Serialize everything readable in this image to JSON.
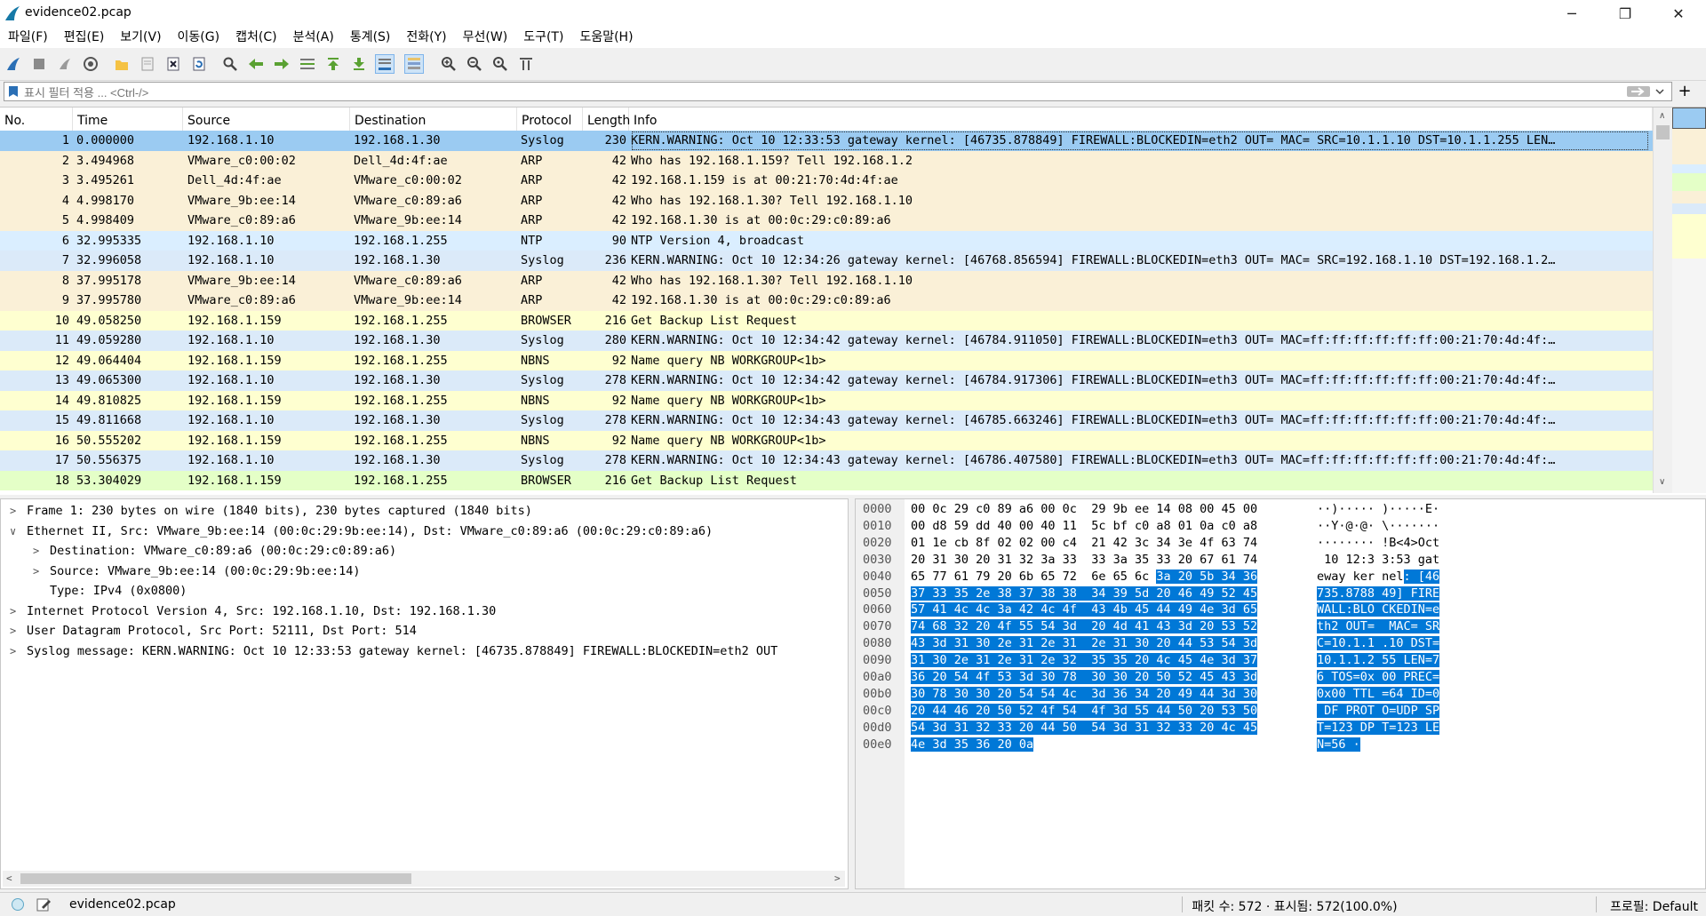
{
  "window": {
    "title": "evidence02.pcap",
    "minimize": "─",
    "maximize": "❐",
    "close": "✕"
  },
  "menu": [
    "파일(F)",
    "편집(E)",
    "보기(V)",
    "이동(G)",
    "캡처(C)",
    "분석(A)",
    "통계(S)",
    "전화(Y)",
    "무선(W)",
    "도구(T)",
    "도움말(H)"
  ],
  "filter": {
    "placeholder": "표시 필터 적용 ... <Ctrl-/>",
    "apply_icon": "arrow-right-icon",
    "add": "+"
  },
  "columns": {
    "no": "No.",
    "time": "Time",
    "source": "Source",
    "destination": "Destination",
    "protocol": "Protocol",
    "length": "Length",
    "info": "Info"
  },
  "colors": {
    "syslog": "#dbeaf9",
    "arp": "#faf0d7",
    "ntp": "#daeeff",
    "browser": "#feffd0",
    "nbns": "#feffd0",
    "last_browser": "#e4ffc7",
    "selected": "#9bcbf2",
    "highlight": "#0078d7"
  },
  "packets": [
    {
      "no": "1",
      "time": "0.000000",
      "src": "192.168.1.10",
      "dst": "192.168.1.30",
      "proto": "Syslog",
      "len": "230",
      "info": "KERN.WARNING: Oct 10 12:33:53 gateway kernel: [46735.878849] FIREWALL:BLOCKEDIN=eth2 OUT= MAC= SRC=10.1.1.10 DST=10.1.1.255 LEN…",
      "kind": "selected"
    },
    {
      "no": "2",
      "time": "3.494968",
      "src": "VMware_c0:00:02",
      "dst": "Dell_4d:4f:ae",
      "proto": "ARP",
      "len": "42",
      "info": "Who has 192.168.1.159? Tell 192.168.1.2",
      "kind": "arp"
    },
    {
      "no": "3",
      "time": "3.495261",
      "src": "Dell_4d:4f:ae",
      "dst": "VMware_c0:00:02",
      "proto": "ARP",
      "len": "42",
      "info": "192.168.1.159 is at 00:21:70:4d:4f:ae",
      "kind": "arp"
    },
    {
      "no": "4",
      "time": "4.998170",
      "src": "VMware_9b:ee:14",
      "dst": "VMware_c0:89:a6",
      "proto": "ARP",
      "len": "42",
      "info": "Who has 192.168.1.30? Tell 192.168.1.10",
      "kind": "arp"
    },
    {
      "no": "5",
      "time": "4.998409",
      "src": "VMware_c0:89:a6",
      "dst": "VMware_9b:ee:14",
      "proto": "ARP",
      "len": "42",
      "info": "192.168.1.30 is at 00:0c:29:c0:89:a6",
      "kind": "arp"
    },
    {
      "no": "6",
      "time": "32.995335",
      "src": "192.168.1.10",
      "dst": "192.168.1.255",
      "proto": "NTP",
      "len": "90",
      "info": "NTP Version 4, broadcast",
      "kind": "ntp"
    },
    {
      "no": "7",
      "time": "32.996058",
      "src": "192.168.1.10",
      "dst": "192.168.1.30",
      "proto": "Syslog",
      "len": "236",
      "info": "KERN.WARNING: Oct 10 12:34:26 gateway kernel: [46768.856594] FIREWALL:BLOCKEDIN=eth3 OUT= MAC= SRC=192.168.1.10 DST=192.168.1.2…",
      "kind": "syslog"
    },
    {
      "no": "8",
      "time": "37.995178",
      "src": "VMware_9b:ee:14",
      "dst": "VMware_c0:89:a6",
      "proto": "ARP",
      "len": "42",
      "info": "Who has 192.168.1.30? Tell 192.168.1.10",
      "kind": "arp"
    },
    {
      "no": "9",
      "time": "37.995780",
      "src": "VMware_c0:89:a6",
      "dst": "VMware_9b:ee:14",
      "proto": "ARP",
      "len": "42",
      "info": "192.168.1.30 is at 00:0c:29:c0:89:a6",
      "kind": "arp"
    },
    {
      "no": "10",
      "time": "49.058250",
      "src": "192.168.1.159",
      "dst": "192.168.1.255",
      "proto": "BROWSER",
      "len": "216",
      "info": "Get Backup List Request",
      "kind": "browser"
    },
    {
      "no": "11",
      "time": "49.059280",
      "src": "192.168.1.10",
      "dst": "192.168.1.30",
      "proto": "Syslog",
      "len": "280",
      "info": "KERN.WARNING: Oct 10 12:34:42 gateway kernel: [46784.911050] FIREWALL:BLOCKEDIN=eth3 OUT= MAC=ff:ff:ff:ff:ff:ff:00:21:70:4d:4f:…",
      "kind": "syslog"
    },
    {
      "no": "12",
      "time": "49.064404",
      "src": "192.168.1.159",
      "dst": "192.168.1.255",
      "proto": "NBNS",
      "len": "92",
      "info": "Name query NB WORKGROUP<1b>",
      "kind": "nbns"
    },
    {
      "no": "13",
      "time": "49.065300",
      "src": "192.168.1.10",
      "dst": "192.168.1.30",
      "proto": "Syslog",
      "len": "278",
      "info": "KERN.WARNING: Oct 10 12:34:42 gateway kernel: [46784.917306] FIREWALL:BLOCKEDIN=eth3 OUT= MAC=ff:ff:ff:ff:ff:ff:00:21:70:4d:4f:…",
      "kind": "syslog"
    },
    {
      "no": "14",
      "time": "49.810825",
      "src": "192.168.1.159",
      "dst": "192.168.1.255",
      "proto": "NBNS",
      "len": "92",
      "info": "Name query NB WORKGROUP<1b>",
      "kind": "nbns"
    },
    {
      "no": "15",
      "time": "49.811668",
      "src": "192.168.1.10",
      "dst": "192.168.1.30",
      "proto": "Syslog",
      "len": "278",
      "info": "KERN.WARNING: Oct 10 12:34:43 gateway kernel: [46785.663246] FIREWALL:BLOCKEDIN=eth3 OUT= MAC=ff:ff:ff:ff:ff:ff:00:21:70:4d:4f:…",
      "kind": "syslog"
    },
    {
      "no": "16",
      "time": "50.555202",
      "src": "192.168.1.159",
      "dst": "192.168.1.255",
      "proto": "NBNS",
      "len": "92",
      "info": "Name query NB WORKGROUP<1b>",
      "kind": "nbns"
    },
    {
      "no": "17",
      "time": "50.556375",
      "src": "192.168.1.10",
      "dst": "192.168.1.30",
      "proto": "Syslog",
      "len": "278",
      "info": "KERN.WARNING: Oct 10 12:34:43 gateway kernel: [46786.407580] FIREWALL:BLOCKEDIN=eth3 OUT= MAC=ff:ff:ff:ff:ff:ff:00:21:70:4d:4f:…",
      "kind": "syslog"
    },
    {
      "no": "18",
      "time": "53.304029",
      "src": "192.168.1.159",
      "dst": "192.168.1.255",
      "proto": "BROWSER",
      "len": "216",
      "info": "Get Backup List Request",
      "kind": "last_browser"
    }
  ],
  "details": [
    {
      "arrow": ">",
      "indent": 0,
      "text": "Frame 1: 230 bytes on wire (1840 bits), 230 bytes captured (1840 bits)"
    },
    {
      "arrow": "∨",
      "indent": 0,
      "text": "Ethernet II, Src: VMware_9b:ee:14 (00:0c:29:9b:ee:14), Dst: VMware_c0:89:a6 (00:0c:29:c0:89:a6)"
    },
    {
      "arrow": ">",
      "indent": 1,
      "text": "Destination: VMware_c0:89:a6 (00:0c:29:c0:89:a6)"
    },
    {
      "arrow": ">",
      "indent": 1,
      "text": "Source: VMware_9b:ee:14 (00:0c:29:9b:ee:14)"
    },
    {
      "arrow": "",
      "indent": 1,
      "text": "Type: IPv4 (0x0800)"
    },
    {
      "arrow": ">",
      "indent": 0,
      "text": "Internet Protocol Version 4, Src: 192.168.1.10, Dst: 192.168.1.30"
    },
    {
      "arrow": ">",
      "indent": 0,
      "text": "User Datagram Protocol, Src Port: 52111, Dst Port: 514"
    },
    {
      "arrow": ">",
      "indent": 0,
      "text": "Syslog message: KERN.WARNING: Oct 10 12:33:53 gateway kernel: [46735.878849] FIREWALL:BLOCKEDIN=eth2 OUT"
    }
  ],
  "bytes": [
    {
      "off": "0000",
      "hex": [
        "00 0c 29 c0 89 a6 00 0c",
        "",
        "29 9b ee 14 08 00 45 00",
        ""
      ],
      "asc": [
        "··)····· )·····E·",
        ""
      ]
    },
    {
      "off": "0010",
      "hex": [
        "00 d8 59 dd 40 00 40 11",
        "",
        "5c bf c0 a8 01 0a c0 a8",
        ""
      ],
      "asc": [
        "··Y·@·@· \\·······",
        ""
      ]
    },
    {
      "off": "0020",
      "hex": [
        "01 1e cb 8f 02 02 00 c4",
        "",
        "21 42 3c 34 3e 4f 63 74",
        ""
      ],
      "asc": [
        "········ !B<4>Oct",
        ""
      ]
    },
    {
      "off": "0030",
      "hex": [
        "20 31 30 20 31 32 3a 33",
        "",
        "33 3a 35 33 20 67 61 74",
        ""
      ],
      "asc": [
        " 10 12:3 3:53 gat",
        ""
      ]
    },
    {
      "off": "0040",
      "hex": [
        "65 77 61 79 20 6b 65 72",
        "",
        "6e 65 6c ",
        "3a 20 5b 34 36"
      ],
      "asc": [
        "eway ker nel",
        ": [46"
      ]
    },
    {
      "off": "0050",
      "hex": [
        "",
        "37 33 35 2e 38 37 38 38",
        "",
        "34 39 5d 20 46 49 52 45"
      ],
      "asc": [
        "",
        "735.8788 49] FIRE"
      ]
    },
    {
      "off": "0060",
      "hex": [
        "",
        "57 41 4c 4c 3a 42 4c 4f",
        "",
        "43 4b 45 44 49 4e 3d 65"
      ],
      "asc": [
        "",
        "WALL:BLO CKEDIN=e"
      ]
    },
    {
      "off": "0070",
      "hex": [
        "",
        "74 68 32 20 4f 55 54 3d",
        "",
        "20 4d 41 43 3d 20 53 52"
      ],
      "asc": [
        "",
        "th2 OUT=  MAC= SR"
      ]
    },
    {
      "off": "0080",
      "hex": [
        "",
        "43 3d 31 30 2e 31 2e 31",
        "",
        "2e 31 30 20 44 53 54 3d"
      ],
      "asc": [
        "",
        "C=10.1.1 .10 DST="
      ]
    },
    {
      "off": "0090",
      "hex": [
        "",
        "31 30 2e 31 2e 31 2e 32",
        "",
        "35 35 20 4c 45 4e 3d 37"
      ],
      "asc": [
        "",
        "10.1.1.2 55 LEN=7"
      ]
    },
    {
      "off": "00a0",
      "hex": [
        "",
        "36 20 54 4f 53 3d 30 78",
        "",
        "30 30 20 50 52 45 43 3d"
      ],
      "asc": [
        "",
        "6 TOS=0x 00 PREC="
      ]
    },
    {
      "off": "00b0",
      "hex": [
        "",
        "30 78 30 30 20 54 54 4c",
        "",
        "3d 36 34 20 49 44 3d 30"
      ],
      "asc": [
        "",
        "0x00 TTL =64 ID=0"
      ]
    },
    {
      "off": "00c0",
      "hex": [
        "",
        "20 44 46 20 50 52 4f 54",
        "",
        "4f 3d 55 44 50 20 53 50"
      ],
      "asc": [
        "",
        " DF PROT O=UDP SP"
      ]
    },
    {
      "off": "00d0",
      "hex": [
        "",
        "54 3d 31 32 33 20 44 50",
        "",
        "54 3d 31 32 33 20 4c 45"
      ],
      "asc": [
        "",
        "T=123 DP T=123 LE"
      ]
    },
    {
      "off": "00e0",
      "hex": [
        "",
        "4e 3d 35 36 20 0a",
        "",
        ""
      ],
      "asc": [
        "",
        "N=56 ·"
      ]
    }
  ],
  "status": {
    "file": "evidence02.pcap",
    "counts": "패킷 수: 572 · 표시됨: 572(100.0%)",
    "profile": "프로필: Default"
  }
}
